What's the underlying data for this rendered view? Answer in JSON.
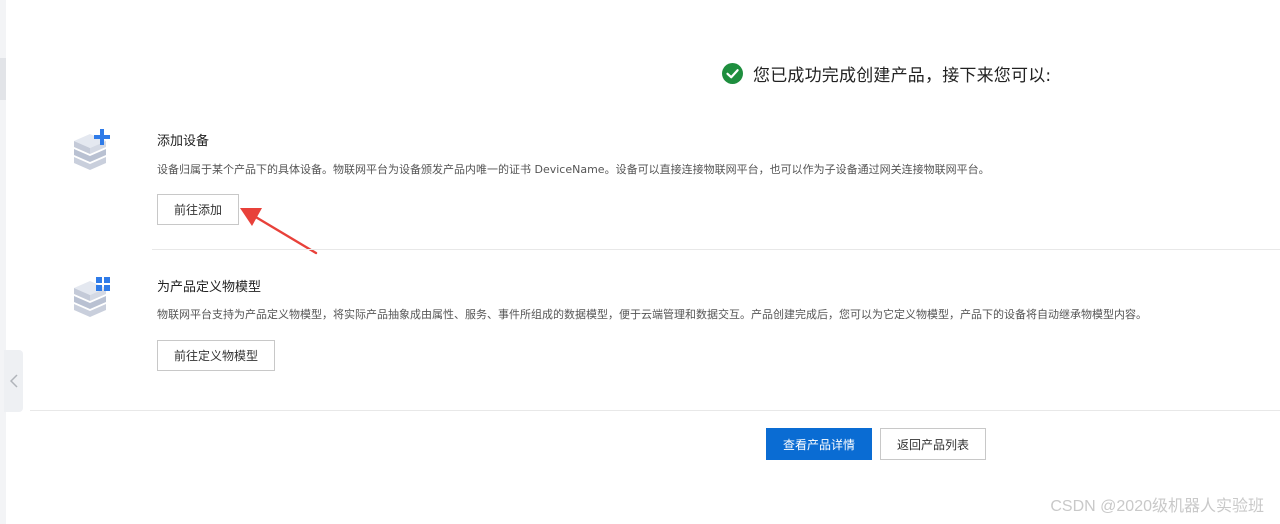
{
  "success": {
    "message": "您已成功完成创建产品，接下来您可以:",
    "icon": "check-circle-icon",
    "color": "#1e8e3e"
  },
  "sections": [
    {
      "icon": "add-device-icon",
      "title": "添加设备",
      "description": "设备归属于某个产品下的具体设备。物联网平台为设备颁发产品内唯一的证书 DeviceName。设备可以直接连接物联网平台，也可以作为子设备通过网关连接物联网平台。",
      "button": "前往添加"
    },
    {
      "icon": "thing-model-icon",
      "title": "为产品定义物模型",
      "description": "物联网平台支持为产品定义物模型，将实际产品抽象成由属性、服务、事件所组成的数据模型，便于云端管理和数据交互。产品创建完成后，您可以为它定义物模型，产品下的设备将自动继承物模型内容。",
      "button": "前往定义物模型"
    }
  ],
  "footer": {
    "view_details": "查看产品详情",
    "back_to_list": "返回产品列表",
    "primary_color": "#0a6cd3"
  },
  "annotation_arrow_color": "#e8413a",
  "watermark": "CSDN @2020级机器人实验班"
}
